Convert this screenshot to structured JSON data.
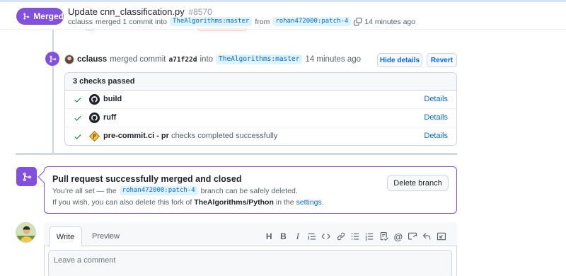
{
  "header": {
    "state": "Merged",
    "title": "Update cnn_classification.py",
    "number": "#8570",
    "meta": {
      "author": "cclauss",
      "action": "merged 1 commit into",
      "base_branch": "TheAlgorithms:master",
      "from_word": "from",
      "head_branch": "rohan472000:patch-4",
      "time": "14 minutes ago"
    }
  },
  "merge_event": {
    "actor": "cclauss",
    "action": "merged commit",
    "sha": "a71f22d",
    "into_word": "into",
    "base_branch": "TheAlgorithms:master",
    "time": "14 minutes ago",
    "hide_details_label": "Hide details",
    "revert_label": "Revert"
  },
  "checks": {
    "summary": "3 checks passed",
    "items": [
      {
        "name": "build",
        "description": "",
        "details_label": "Details",
        "icon": "github-icon"
      },
      {
        "name": "ruff",
        "description": "",
        "details_label": "Details",
        "icon": "github-icon"
      },
      {
        "name": "pre-commit.ci - pr",
        "description": "checks completed successfully",
        "details_label": "Details",
        "icon": "pre-commit-icon"
      }
    ]
  },
  "merged_box": {
    "title": "Pull request successfully merged and closed",
    "line1_prefix": "You’re all set — the",
    "branch": "rohan472000:patch-4",
    "line1_suffix": "branch can be safely deleted.",
    "line2_prefix": "If you wish, you can also delete this fork of",
    "repo": "TheAlgorithms/Python",
    "line2_middle": "in the",
    "settings_link": "settings",
    "line2_end": ".",
    "delete_label": "Delete branch"
  },
  "comment": {
    "write_tab": "Write",
    "preview_tab": "Preview",
    "placeholder": "Leave a comment",
    "toolbar": [
      "heading-icon",
      "bold-icon",
      "italic-icon",
      "quote-icon",
      "code-icon",
      "link-icon",
      "unordered-list-icon",
      "ordered-list-icon",
      "task-list-icon",
      "mention-icon",
      "reference-icon",
      "reply-icon",
      "fullscreen-icon"
    ]
  },
  "colors": {
    "merged_purple": "#8250df",
    "link_blue": "#0969da",
    "success_green": "#1a7f37",
    "border": "#d0d7de"
  }
}
